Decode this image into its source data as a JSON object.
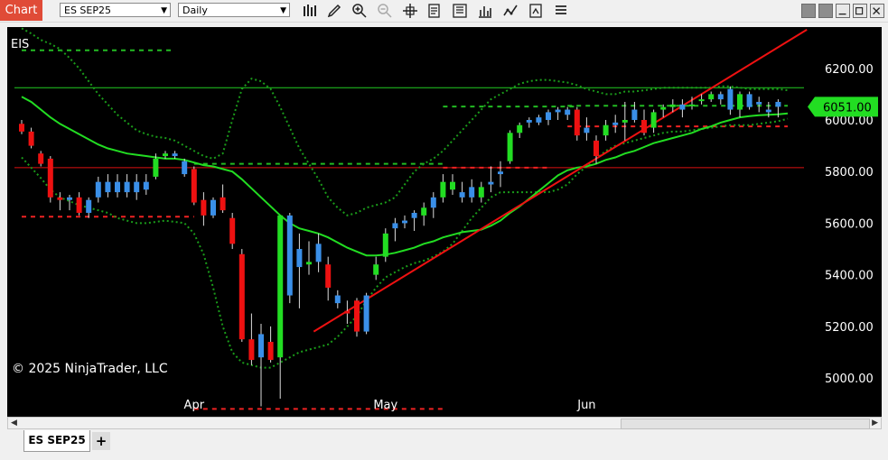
{
  "toolbar": {
    "chart_label": "Chart",
    "instrument": "ES SEP25",
    "interval": "Daily",
    "icons": [
      "bar-type-icon",
      "drawing-tool-icon",
      "zoom-in-icon",
      "zoom-out-icon",
      "crosshair-icon",
      "chart-properties-icon",
      "data-box-icon",
      "strategies-icon",
      "indicators-icon",
      "chart-trader-icon",
      "templates-icon"
    ],
    "window_buttons": [
      "link-button",
      "group-button",
      "minimize-button",
      "maximize-button",
      "close-button"
    ]
  },
  "tabs": {
    "active": "ES SEP25",
    "add": "+"
  },
  "colors": {
    "background": "#000000",
    "up_candle": "#22dd22",
    "down_candle": "#ee1111",
    "blue_candle": "#3a8fe8",
    "ma_line": "#22dd22",
    "bands": "#1a9c1a",
    "trend_line": "#ee1111",
    "price_marker": "#22dd22"
  },
  "chart_data": {
    "type": "candlestick",
    "instrument_label": "EIS",
    "watermark": "© 2025 NinjaTrader, LLC",
    "ylim": [
      4850,
      6360
    ],
    "y_ticks": [
      5000,
      5200,
      5400,
      5600,
      5800,
      6000,
      6200
    ],
    "y_tick_labels": [
      "5000.00",
      "5200.00",
      "5400.00",
      "5600.00",
      "5800.00",
      "6000.00",
      "6200.00"
    ],
    "x_tick_labels": [
      {
        "label": "Apr",
        "index": 18
      },
      {
        "label": "May",
        "index": 38
      },
      {
        "label": "Jun",
        "index": 59
      }
    ],
    "last_price": 6051,
    "last_price_label": "6051.00",
    "candles": [
      [
        5985,
        6000,
        5945,
        5955,
        "d"
      ],
      [
        5955,
        5970,
        5890,
        5900,
        "d"
      ],
      [
        5870,
        5880,
        5820,
        5830,
        "d"
      ],
      [
        5850,
        5860,
        5680,
        5700,
        "d"
      ],
      [
        5700,
        5720,
        5650,
        5690,
        "d"
      ],
      [
        5690,
        5710,
        5650,
        5700,
        "b"
      ],
      [
        5700,
        5720,
        5630,
        5640,
        "d"
      ],
      [
        5640,
        5700,
        5620,
        5690,
        "b"
      ],
      [
        5700,
        5780,
        5680,
        5760,
        "b"
      ],
      [
        5760,
        5790,
        5700,
        5720,
        "b"
      ],
      [
        5720,
        5790,
        5700,
        5760,
        "b"
      ],
      [
        5760,
        5790,
        5700,
        5720,
        "b"
      ],
      [
        5720,
        5790,
        5690,
        5760,
        "b"
      ],
      [
        5760,
        5790,
        5710,
        5730,
        "b"
      ],
      [
        5780,
        5870,
        5770,
        5850,
        "u"
      ],
      [
        5860,
        5880,
        5850,
        5870,
        "u"
      ],
      [
        5870,
        5880,
        5850,
        5860,
        "b"
      ],
      [
        5840,
        5850,
        5780,
        5790,
        "b"
      ],
      [
        5810,
        5820,
        5670,
        5680,
        "d"
      ],
      [
        5690,
        5720,
        5590,
        5630,
        "d"
      ],
      [
        5630,
        5700,
        5620,
        5690,
        "b"
      ],
      [
        5700,
        5750,
        5640,
        5650,
        "d"
      ],
      [
        5620,
        5640,
        5500,
        5520,
        "d"
      ],
      [
        5480,
        5500,
        5140,
        5150,
        "d"
      ],
      [
        5150,
        5250,
        5050,
        5070,
        "d"
      ],
      [
        5080,
        5210,
        4890,
        5170,
        "b"
      ],
      [
        5140,
        5200,
        5060,
        5070,
        "d"
      ],
      [
        5080,
        5620,
        4920,
        5630,
        "u"
      ],
      [
        5630,
        5640,
        5290,
        5320,
        "b"
      ],
      [
        5500,
        5560,
        5270,
        5430,
        "b"
      ],
      [
        5440,
        5530,
        5400,
        5450,
        "u"
      ],
      [
        5450,
        5560,
        5410,
        5520,
        "b"
      ],
      [
        5440,
        5470,
        5300,
        5350,
        "d"
      ],
      [
        5320,
        5340,
        5270,
        5290,
        "b"
      ],
      [
        5260,
        5300,
        5210,
        5250,
        "d"
      ],
      [
        5300,
        5310,
        5160,
        5180,
        "d"
      ],
      [
        5180,
        5330,
        5170,
        5320,
        "b"
      ],
      [
        5400,
        5470,
        5380,
        5440,
        "u"
      ],
      [
        5470,
        5580,
        5450,
        5560,
        "u"
      ],
      [
        5580,
        5620,
        5530,
        5600,
        "b"
      ],
      [
        5600,
        5630,
        5580,
        5610,
        "b"
      ],
      [
        5620,
        5650,
        5570,
        5640,
        "b"
      ],
      [
        5630,
        5680,
        5590,
        5660,
        "u"
      ],
      [
        5660,
        5720,
        5620,
        5700,
        "b"
      ],
      [
        5700,
        5790,
        5680,
        5760,
        "u"
      ],
      [
        5760,
        5790,
        5710,
        5730,
        "u"
      ],
      [
        5720,
        5760,
        5680,
        5700,
        "b"
      ],
      [
        5740,
        5770,
        5680,
        5700,
        "b"
      ],
      [
        5700,
        5760,
        5680,
        5740,
        "u"
      ],
      [
        5750,
        5820,
        5720,
        5760,
        "b"
      ],
      [
        5800,
        5840,
        5740,
        5790,
        "b"
      ],
      [
        5840,
        5960,
        5830,
        5950,
        "u"
      ],
      [
        5950,
        5990,
        5930,
        5980,
        "u"
      ],
      [
        5990,
        6010,
        5970,
        6000,
        "b"
      ],
      [
        6010,
        6020,
        5980,
        5990,
        "b"
      ],
      [
        6000,
        6040,
        5980,
        6030,
        "b"
      ],
      [
        6030,
        6050,
        6000,
        6040,
        "b"
      ],
      [
        6040,
        6050,
        6000,
        6020,
        "b"
      ],
      [
        6040,
        6050,
        5920,
        5940,
        "d"
      ],
      [
        5950,
        6010,
        5920,
        5970,
        "b"
      ],
      [
        5920,
        5940,
        5830,
        5860,
        "d"
      ],
      [
        5940,
        6000,
        5920,
        5980,
        "u"
      ],
      [
        5980,
        6020,
        5950,
        5990,
        "b"
      ],
      [
        5990,
        6070,
        5920,
        6000,
        "u"
      ],
      [
        6000,
        6070,
        5990,
        6040,
        "b"
      ],
      [
        6000,
        6040,
        5940,
        5950,
        "d"
      ],
      [
        5970,
        6040,
        5950,
        6030,
        "u"
      ],
      [
        6040,
        6060,
        6010,
        6050,
        "u"
      ],
      [
        6050,
        6080,
        6030,
        6060,
        "u"
      ],
      [
        6060,
        6080,
        6010,
        6040,
        "b"
      ],
      [
        6060,
        6090,
        6040,
        6060,
        "u"
      ],
      [
        6080,
        6100,
        6060,
        6080,
        "u"
      ],
      [
        6080,
        6110,
        6070,
        6100,
        "u"
      ],
      [
        6100,
        6110,
        6060,
        6080,
        "b"
      ],
      [
        6120,
        6130,
        6020,
        6040,
        "b"
      ],
      [
        6040,
        6110,
        6010,
        6100,
        "u"
      ],
      [
        6100,
        6110,
        6040,
        6050,
        "b"
      ],
      [
        6060,
        6090,
        6030,
        6070,
        "b"
      ],
      [
        6040,
        6070,
        6010,
        6030,
        "b"
      ],
      [
        6070,
        6080,
        6010,
        6051,
        "b"
      ]
    ],
    "ma": [
      6090,
      6070,
      6040,
      6010,
      5985,
      5965,
      5945,
      5925,
      5905,
      5890,
      5880,
      5870,
      5865,
      5860,
      5855,
      5850,
      5850,
      5845,
      5835,
      5825,
      5820,
      5810,
      5800,
      5770,
      5735,
      5700,
      5665,
      5630,
      5600,
      5580,
      5570,
      5560,
      5545,
      5525,
      5505,
      5490,
      5475,
      5475,
      5478,
      5485,
      5495,
      5505,
      5520,
      5530,
      5545,
      5555,
      5565,
      5570,
      5575,
      5590,
      5610,
      5640,
      5665,
      5695,
      5725,
      5755,
      5785,
      5805,
      5815,
      5820,
      5830,
      5845,
      5855,
      5870,
      5880,
      5895,
      5910,
      5920,
      5930,
      5940,
      5950,
      5965,
      5975,
      5990,
      6000,
      6010,
      6015,
      6018,
      6020,
      6022,
      6025
    ],
    "upper_band": [
      6355,
      6335,
      6310,
      6295,
      6275,
      6240,
      6200,
      6150,
      6100,
      6060,
      6020,
      5990,
      5960,
      5945,
      5935,
      5930,
      5920,
      5900,
      5880,
      5860,
      5850,
      5870,
      6000,
      6120,
      6160,
      6150,
      6120,
      6050,
      5970,
      5890,
      5830,
      5770,
      5700,
      5660,
      5630,
      5640,
      5660,
      5670,
      5680,
      5700,
      5750,
      5800,
      5830,
      5850,
      5880,
      5920,
      5960,
      6000,
      6040,
      6080,
      6100,
      6120,
      6140,
      6150,
      6155,
      6155,
      6150,
      6145,
      6135,
      6120,
      6110,
      6100,
      6100,
      6110,
      6110,
      6115,
      6120,
      6125,
      6125,
      6125,
      6125,
      6125,
      6125,
      6130,
      6130,
      6125,
      6120,
      6120,
      6120,
      6120,
      6115
    ],
    "lower_band": [
      5855,
      5815,
      5775,
      5730,
      5700,
      5685,
      5670,
      5660,
      5650,
      5640,
      5620,
      5610,
      5600,
      5600,
      5605,
      5610,
      5605,
      5600,
      5560,
      5480,
      5350,
      5200,
      5100,
      5060,
      5050,
      5040,
      5040,
      5060,
      5080,
      5100,
      5110,
      5120,
      5130,
      5160,
      5200,
      5240,
      5300,
      5350,
      5390,
      5410,
      5430,
      5445,
      5455,
      5470,
      5490,
      5520,
      5570,
      5620,
      5660,
      5700,
      5720,
      5720,
      5720,
      5720,
      5720,
      5720,
      5730,
      5750,
      5790,
      5820,
      5850,
      5880,
      5900,
      5910,
      5920,
      5930,
      5940,
      5950,
      5955,
      5955,
      5960,
      5965,
      5970,
      5975,
      5980,
      5980,
      5980,
      5985,
      5990,
      5995,
      6005
    ],
    "horizontal_lines": [
      {
        "price": 6125,
        "color": "green",
        "style": "solid"
      },
      {
        "price": 5815,
        "color": "red",
        "style": "solid"
      }
    ],
    "dashed_levels": [
      {
        "price": 6270,
        "from": 0,
        "to": 16,
        "color": "green"
      },
      {
        "price": 5625,
        "from": 0,
        "to": 18,
        "color": "red"
      },
      {
        "price": 5830,
        "from": 18,
        "to": 44,
        "color": "green"
      },
      {
        "price": 4880,
        "from": 18,
        "to": 44,
        "color": "red"
      },
      {
        "price": 6052,
        "from": 44,
        "to": 58,
        "color": "green"
      },
      {
        "price": 5815,
        "from": 44,
        "to": 55,
        "color": "red"
      },
      {
        "price": 6055,
        "from": 57,
        "to": 80,
        "color": "green"
      },
      {
        "price": 5975,
        "from": 57,
        "to": 80,
        "color": "red"
      }
    ],
    "trend_line": {
      "from": [
        30.5,
        5180
      ],
      "to": [
        82,
        6350
      ]
    }
  }
}
